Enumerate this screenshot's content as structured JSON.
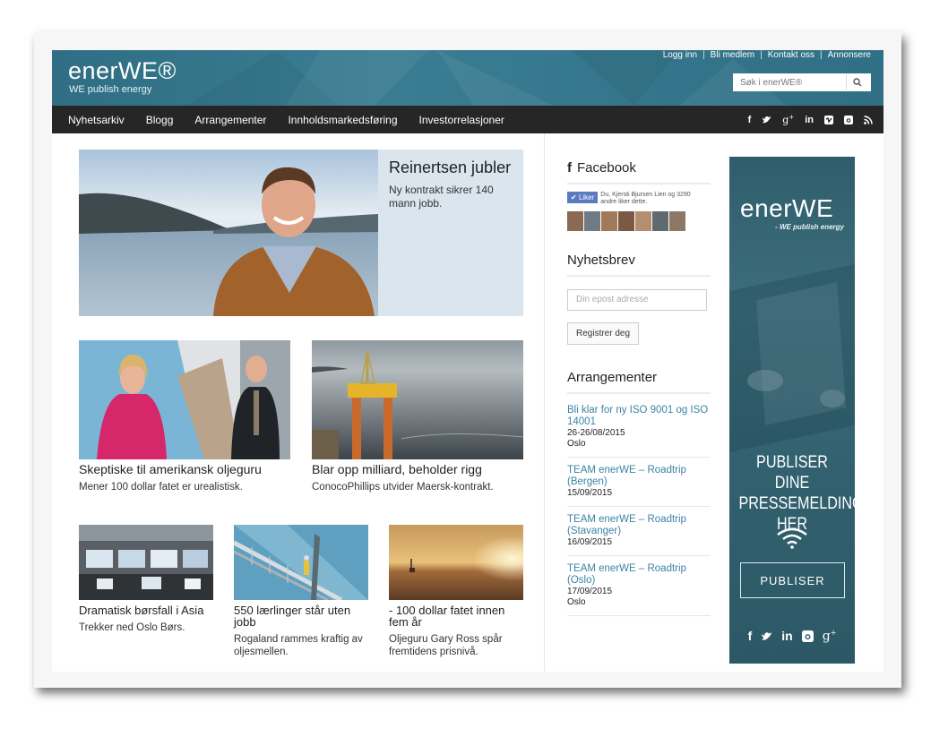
{
  "header": {
    "logo": "enerWE®",
    "tagline": "WE publish energy",
    "links": [
      "Logg inn",
      "Bli medlem",
      "Kontakt oss",
      "Annonsere"
    ],
    "search_placeholder": "Søk i enerWE®"
  },
  "nav": {
    "items": [
      "Nyhetsarkiv",
      "Blogg",
      "Arrangementer",
      "Innholdsmarkedsføring",
      "Investorrelasjoner"
    ],
    "social": [
      "f",
      "t",
      "g+",
      "in",
      "v",
      "ig",
      "rss"
    ]
  },
  "hero": {
    "title": "Reinertsen jubler",
    "subtitle": "Ny kontrakt sikrer 140 mann jobb."
  },
  "articles_mid": [
    {
      "title": "Skeptiske til amerikansk oljeguru",
      "subtitle": "Mener 100 dollar fatet er urealistisk."
    },
    {
      "title": "Blar opp milliard, beholder rigg",
      "subtitle": "ConocoPhillips utvider Maersk-kontrakt."
    }
  ],
  "articles_small": [
    {
      "title": "Dramatisk børsfall i Asia",
      "subtitle": "Trekker ned Oslo Børs."
    },
    {
      "title": "550 lærlinger står uten jobb",
      "subtitle": "Rogaland rammes kraftig av oljesmellen."
    },
    {
      "title": "- 100 dollar fatet innen fem år",
      "subtitle": "Oljeguru Gary Ross spår fremtidens prisnivå."
    }
  ],
  "sidebar": {
    "facebook_heading": "Facebook",
    "like_label": "Liker",
    "like_text": "Du, Kjersti Bjursen Lien og 3290 andre liker dette.",
    "newsletter_heading": "Nyhetsbrev",
    "email_placeholder": "Din epost adresse",
    "register_label": "Registrer deg",
    "events_heading": "Arrangementer",
    "events": [
      {
        "title": "Bli klar for ny ISO 9001 og ISO 14001",
        "date": "26-26/08/2015",
        "place": "Oslo"
      },
      {
        "title": "TEAM enerWE – Roadtrip (Bergen)",
        "date": "15/09/2015",
        "place": ""
      },
      {
        "title": "TEAM enerWE – Roadtrip (Stavanger)",
        "date": "16/09/2015",
        "place": ""
      },
      {
        "title": "TEAM enerWE – Roadtrip (Oslo)",
        "date": "17/09/2015",
        "place": "Oslo"
      }
    ]
  },
  "ad": {
    "logo": "enerWE",
    "tagline": "- WE publish energy",
    "text": "PUBLISER DINE PRESSEMELDINGER HER",
    "button": "PUBLISER"
  }
}
